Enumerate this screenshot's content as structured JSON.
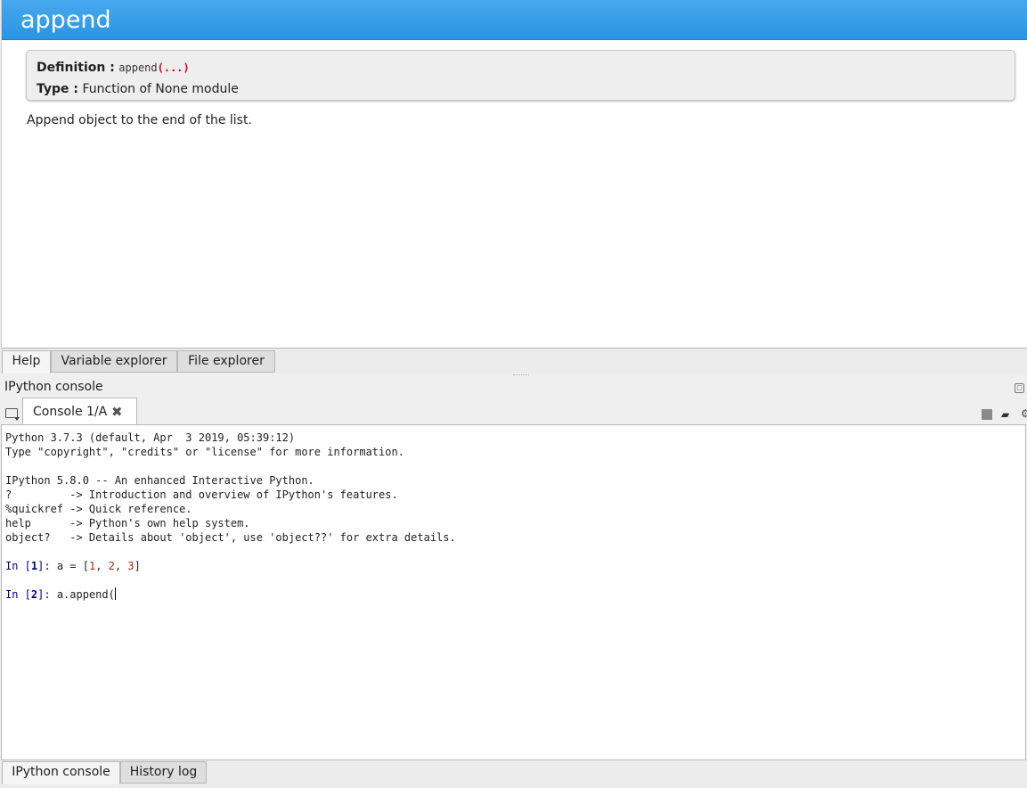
{
  "help": {
    "title": "append",
    "definition_label": "Definition :",
    "definition_name": "append",
    "definition_args": "(...)",
    "type_label": "Type :",
    "type_value": "Function of None module",
    "docstring": "Append object to the end of the list."
  },
  "upper_tabs": [
    {
      "label": "Help",
      "active": true
    },
    {
      "label": "Variable explorer",
      "active": false
    },
    {
      "label": "File explorer",
      "active": false
    }
  ],
  "console": {
    "pane_title": "IPython console",
    "tab_label": "Console 1/A",
    "close_glyph": "✖",
    "banner": [
      "Python 3.7.3 (default, Apr  3 2019, 05:39:12)",
      "Type \"copyright\", \"credits\" or \"license\" for more information.",
      "",
      "IPython 5.8.0 -- An enhanced Interactive Python.",
      "?         -> Introduction and overview of IPython's features.",
      "%quickref -> Quick reference.",
      "help      -> Python's own help system.",
      "object?   -> Details about 'object', use 'object??' for extra details."
    ],
    "prompt_prefix": "In [",
    "prompt_suffix": "]: ",
    "cell1": {
      "number": "1",
      "code_start": "a = [",
      "n1": "1",
      "sep1": ", ",
      "n2": "2",
      "sep2": ", ",
      "n3": "3",
      "code_end": "]"
    },
    "cell2": {
      "number": "2",
      "code": "a.append("
    }
  },
  "bottom_tabs": [
    {
      "label": "IPython console",
      "active": true
    },
    {
      "label": "History log",
      "active": false
    }
  ],
  "icons": {
    "undock": "undock-icon",
    "browse_folder": "folder-icon",
    "interrupt": "stop-icon",
    "clear": "eraser-icon",
    "options": "gear-icon"
  },
  "colors": {
    "title_bar": "#2a95e4",
    "prompt": "#000080",
    "number_literal": "#a0290a",
    "signature_paren": "#d0021b"
  }
}
